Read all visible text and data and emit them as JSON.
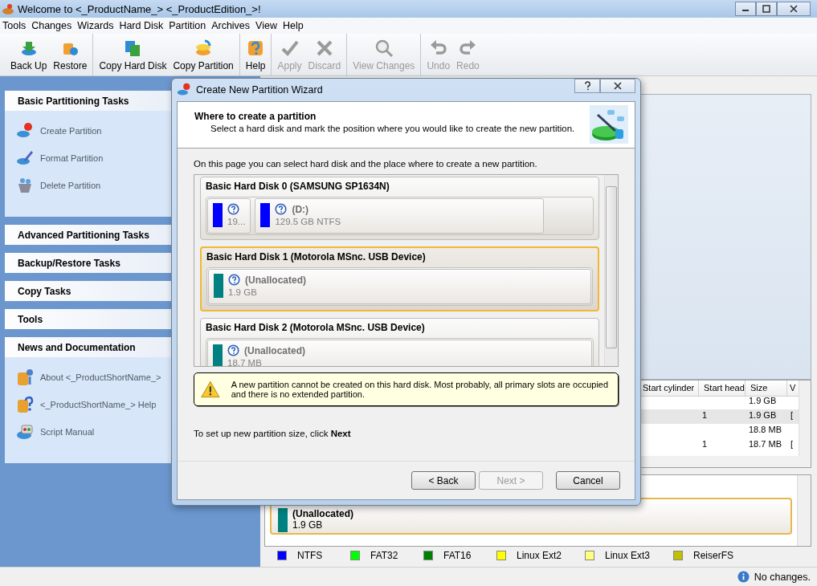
{
  "window": {
    "title": "Welcome to <_ProductName_> <_ProductEdition_>!"
  },
  "menu": [
    "Tools",
    "Changes",
    "Wizards",
    "Hard Disk",
    "Partition",
    "Archives",
    "View",
    "Help"
  ],
  "toolbar_groups": [
    {
      "buttons": [
        {
          "label": "Back Up",
          "disabled": false
        },
        {
          "label": "Restore",
          "disabled": false
        }
      ]
    },
    {
      "buttons": [
        {
          "label": "Copy Hard Disk",
          "disabled": false
        },
        {
          "label": "Copy Partition",
          "disabled": false
        }
      ]
    },
    {
      "buttons": [
        {
          "label": "Help",
          "disabled": false
        }
      ]
    },
    {
      "buttons": [
        {
          "label": "Apply",
          "disabled": true
        },
        {
          "label": "Discard",
          "disabled": true
        }
      ]
    },
    {
      "buttons": [
        {
          "label": "View Changes",
          "disabled": true
        }
      ]
    },
    {
      "buttons": [
        {
          "label": "Undo",
          "disabled": true
        },
        {
          "label": "Redo",
          "disabled": true
        }
      ]
    }
  ],
  "task_panels": [
    {
      "title": "Basic Partitioning Tasks",
      "expanded": true,
      "items": [
        "Create Partition",
        "Format Partition",
        "Delete Partition"
      ]
    },
    {
      "title": "Advanced Partitioning Tasks",
      "expanded": false
    },
    {
      "title": "Backup/Restore Tasks",
      "expanded": false
    },
    {
      "title": "Copy Tasks",
      "expanded": false
    },
    {
      "title": "Tools",
      "expanded": false
    },
    {
      "title": "News and Documentation",
      "expanded": true,
      "items": [
        "About <_ProductShortName_>",
        "<_ProductShortName_> Help",
        "Script Manual"
      ]
    }
  ],
  "table": {
    "columns": [
      "Start cylinder",
      "Start head",
      "Size",
      "V"
    ],
    "rows": [
      {
        "cells": [
          null,
          null,
          "1.9 GB",
          null
        ],
        "selected": false
      },
      {
        "cells": [
          null,
          "1",
          "1.9 GB",
          "["
        ],
        "selected": true
      },
      {
        "cells": [
          null,
          null,
          "18.8 MB",
          null
        ],
        "selected": false
      },
      {
        "cells": [
          null,
          "1",
          "18.7 MB",
          "["
        ],
        "selected": false
      }
    ]
  },
  "disk_map": {
    "partitions": [
      {
        "label": "(Unallocated)",
        "size": "1.9 GB",
        "color": "#008080",
        "selected": true
      }
    ]
  },
  "legend": [
    {
      "label": "NTFS",
      "color": "#0000ff"
    },
    {
      "label": "FAT32",
      "color": "#00ff00"
    },
    {
      "label": "FAT16",
      "color": "#008000"
    },
    {
      "label": "Linux Ext2",
      "color": "#ffff00"
    },
    {
      "label": "Linux Ext3",
      "color": "#ffff80"
    },
    {
      "label": "ReiserFS",
      "color": "#c0c000"
    }
  ],
  "status": "No changes.",
  "dialog": {
    "title": "Create New Partition Wizard",
    "heading": "Where to create a partition",
    "subheading": "Select a hard disk and mark the position where you would like to create the new partition.",
    "intro": "On this page you can select hard disk and the place where to create a new partition.",
    "disks": [
      {
        "name": "Basic Hard Disk 0 (SAMSUNG SP1634N)",
        "selected": false,
        "partitions": [
          {
            "size": "19...",
            "color": "#0000ff"
          },
          {
            "label": "(D:)",
            "size": "129.5 GB NTFS",
            "color": "#0000ff"
          }
        ]
      },
      {
        "name": "Basic Hard Disk 1 (Motorola MSnc. USB Device)",
        "selected": true,
        "partitions": [
          {
            "label": "(Unallocated)",
            "size": "1.9 GB",
            "color": "#008080"
          }
        ]
      },
      {
        "name": "Basic Hard Disk 2 (Motorola MSnc. USB Device)",
        "selected": false,
        "partitions": [
          {
            "label": "(Unallocated)",
            "size": "18.7 MB",
            "color": "#008080"
          }
        ]
      }
    ],
    "warning": "A new partition cannot be created on this hard disk. Most probably, all primary slots are occupied and there is no extended partition.",
    "hint": "To set up new partition size, click **Next**",
    "buttons": [
      {
        "label": "< Back",
        "disabled": false
      },
      {
        "label": "Next >",
        "disabled": true
      },
      {
        "label": "Cancel",
        "disabled": false
      }
    ]
  }
}
